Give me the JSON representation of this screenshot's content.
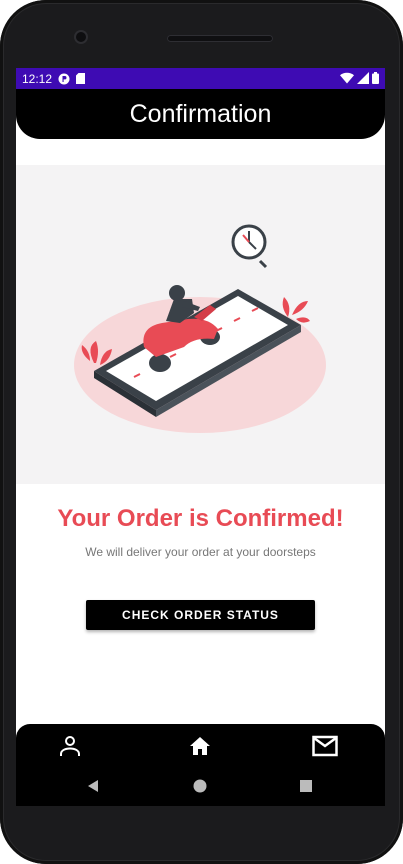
{
  "status_bar": {
    "time": "12:12",
    "left_icons": [
      "p-badge-icon",
      "sim-card-icon"
    ],
    "right_icons": [
      "wifi-icon",
      "signal-icon",
      "battery-icon"
    ],
    "color": "#3e0bb3"
  },
  "header": {
    "title": "Confirmation"
  },
  "hero": {
    "illustration": "delivery-scooter-on-phone",
    "clock_icon": "clock-icon"
  },
  "main": {
    "headline": "Your Order is Confirmed!",
    "subtext": "We will deliver your order at your doorsteps",
    "button_label": "CHECK ORDER STATUS",
    "accent_color": "#e84b55"
  },
  "bottom_nav": {
    "items": [
      {
        "icon": "person-icon"
      },
      {
        "icon": "home-icon"
      },
      {
        "icon": "mail-icon"
      }
    ]
  },
  "system_nav": {
    "back": "back-icon",
    "home": "home-circle-icon",
    "recents": "recents-icon"
  }
}
